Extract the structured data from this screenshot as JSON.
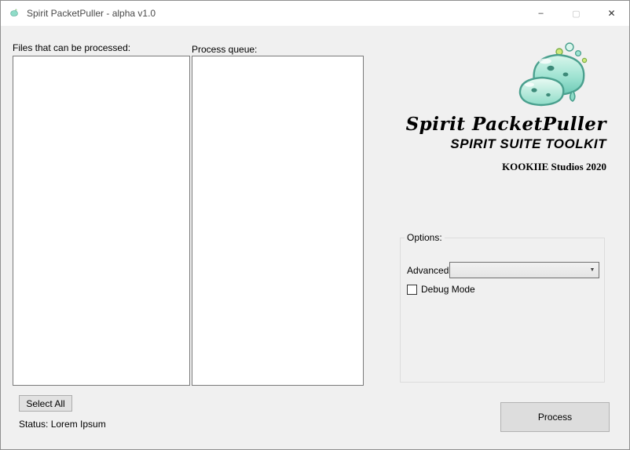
{
  "window": {
    "title": "Spirit PacketPuller - alpha v1.0",
    "minimize_glyph": "–",
    "close_glyph": "✕"
  },
  "labels": {
    "files_list": "Files that can be processed:",
    "process_queue": "Process queue:"
  },
  "branding": {
    "title": "Spirit PacketPuller",
    "subtitle": "SPIRIT SUITE TOOLKIT",
    "credit": "KOOKIIE Studios 2020",
    "logo_colors": {
      "slime_light": "#d9f6ec",
      "slime_mid": "#8fdcc8",
      "slime_dark": "#4aa08e",
      "bubble_green": "#cfe97a",
      "bubble_teal": "#9fe3d2"
    }
  },
  "options": {
    "group_label": "Options:",
    "advanced_label": "Advanced:",
    "advanced_value": "",
    "debug_label": "Debug Mode",
    "debug_checked": false
  },
  "buttons": {
    "select_all": "Select All",
    "process": "Process"
  },
  "status": {
    "text": "Status: Lorem Ipsum"
  }
}
